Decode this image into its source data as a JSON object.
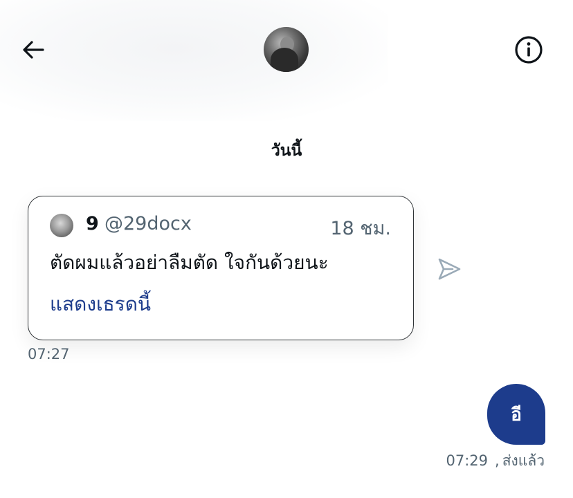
{
  "header": {
    "back_icon": "arrow-left-icon",
    "info_icon": "info-icon",
    "avatar": "profile-photo"
  },
  "conversation": {
    "date_separator": "วันนี้",
    "shared_tweet": {
      "author_name": "9",
      "author_handle": "@29docx",
      "time_ago": "18 ชม.",
      "text": "ตัดผมแล้วอย่าลืมตัด ใจกันด้วยนะ",
      "show_thread_label": "แสดงเธรดนี้"
    },
    "share_icon": "send-icon",
    "received_time": "07:27",
    "sent_message": {
      "text": "อี",
      "time": "07:29",
      "separator": ",",
      "status": "ส่งแล้ว"
    }
  },
  "colors": {
    "accent": "#1d3c8c",
    "secondary_text": "#536471",
    "primary_text": "#0f1419"
  }
}
